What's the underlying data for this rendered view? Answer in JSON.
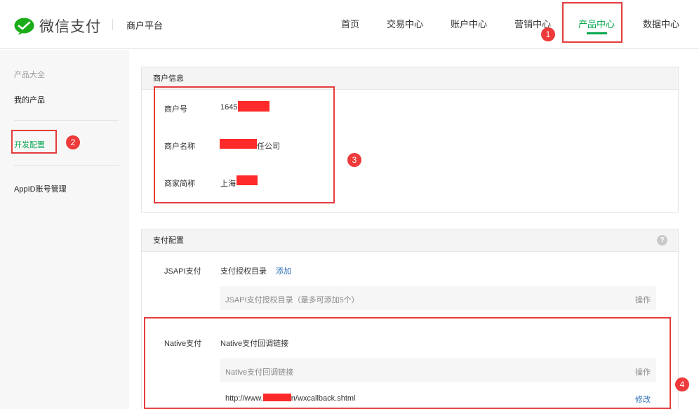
{
  "header": {
    "brand": "微信支付",
    "platform": "商户平台",
    "nav": [
      {
        "label": "首页"
      },
      {
        "label": "交易中心"
      },
      {
        "label": "账户中心"
      },
      {
        "label": "营销中心"
      },
      {
        "label": "产品中心"
      },
      {
        "label": "数据中心"
      }
    ],
    "active_nav": "产品中心"
  },
  "sidebar": {
    "heading": "产品大全",
    "items": [
      {
        "label": "我的产品"
      },
      {
        "label": "开发配置"
      },
      {
        "label": "AppID账号管理"
      }
    ],
    "active_item": "开发配置"
  },
  "merchant_info": {
    "title": "商户信息",
    "rows": [
      {
        "label": "商户号",
        "value": "1645",
        "suffix": ""
      },
      {
        "label": "商户名称",
        "value": "",
        "suffix": "任公司"
      },
      {
        "label": "商家简称",
        "value": "上海",
        "suffix": ""
      }
    ]
  },
  "pay_config": {
    "title": "支付配置",
    "help_icon": "?",
    "jsapi": {
      "label": "JSAPI支付",
      "item_title": "支付授权目录",
      "add_link": "添加",
      "table_header": "JSAPI支付授权目录（最多可添加5个）",
      "table_action_header": "操作"
    },
    "native": {
      "label": "Native支付",
      "item_title": "Native支付回调链接",
      "table_header": "Native支付回调链接",
      "table_action_header": "操作",
      "url_prefix": "http://www.",
      "url_suffix": "n/wxcallback.shtml",
      "edit_link": "修改"
    }
  },
  "annotations": [
    "1",
    "2",
    "3",
    "4"
  ],
  "colors": {
    "accent_green": "#07a74f",
    "annotation_red": "#e53c3c",
    "link_blue": "#2a6cb5",
    "redaction": "#ff2b2b"
  }
}
